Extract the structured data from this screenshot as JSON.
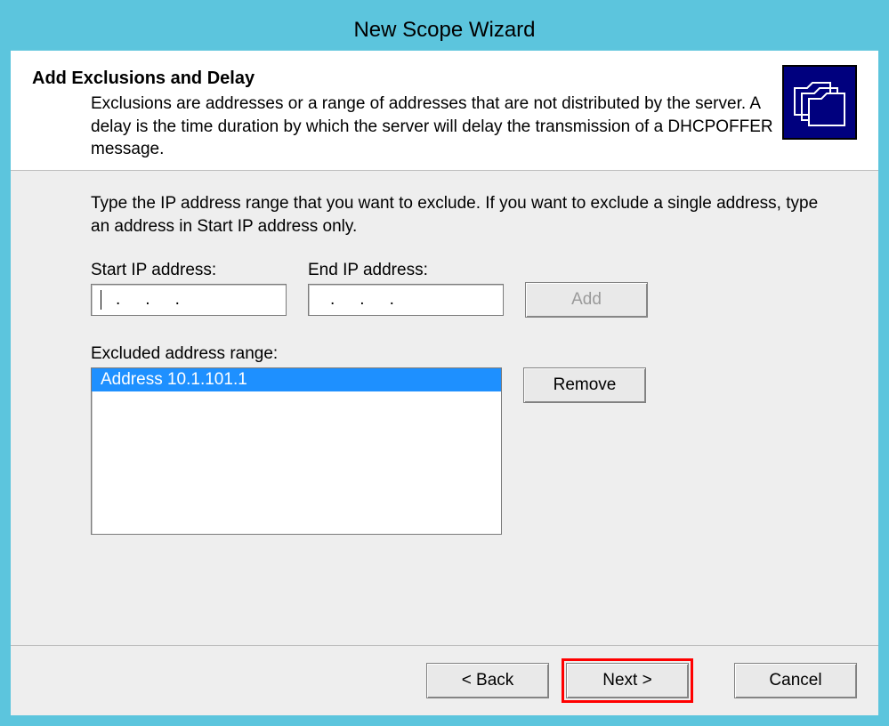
{
  "window": {
    "title": "New Scope Wizard"
  },
  "header": {
    "title": "Add Exclusions and Delay",
    "subtitle": "Exclusions are addresses or a range of addresses that are not distributed by the server. A delay is the time duration by which the server will delay the transmission of a DHCPOFFER message."
  },
  "content": {
    "instructions": "Type the IP address range that you want to exclude. If you want to exclude a single address, type an address in Start IP address only.",
    "start_label": "Start IP address:",
    "end_label": "End IP address:",
    "add_label": "Add",
    "excluded_label": "Excluded address range:",
    "remove_label": "Remove",
    "excluded_items": [
      "Address 10.1.101.1"
    ]
  },
  "footer": {
    "back": "< Back",
    "next": "Next >",
    "cancel": "Cancel"
  }
}
